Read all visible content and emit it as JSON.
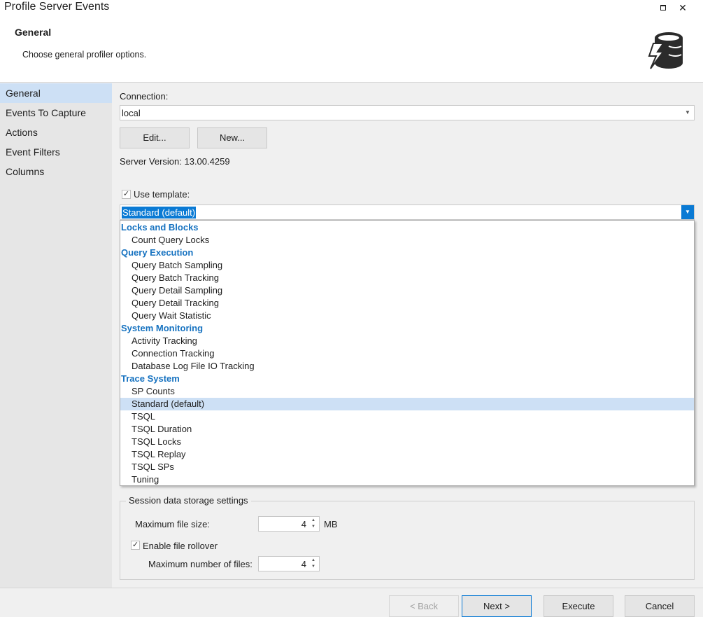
{
  "window": {
    "title": "Profile Server Events",
    "maximize_icon": "maximize-icon",
    "close_icon": "close-icon",
    "close_glyph": "✕"
  },
  "header": {
    "title": "General",
    "subtitle": "Choose general profiler options.",
    "icon": "database-lightning-icon"
  },
  "sidebar": {
    "items": [
      {
        "label": "General"
      },
      {
        "label": "Events To Capture"
      },
      {
        "label": "Actions"
      },
      {
        "label": "Event Filters"
      },
      {
        "label": "Columns"
      }
    ],
    "active": "General"
  },
  "connection": {
    "label": "Connection:",
    "value": "local",
    "edit_label": "Edit...",
    "new_label": "New..."
  },
  "server": {
    "version_text": "Server Version: 13.00.4259"
  },
  "template": {
    "checkbox_label": "Use template:",
    "checked": true,
    "selected": "Standard (default)",
    "groups": [
      {
        "name": "Locks and Blocks",
        "items": [
          "Count Query Locks"
        ]
      },
      {
        "name": "Query Execution",
        "items": [
          "Query Batch Sampling",
          "Query Batch Tracking",
          "Query Detail Sampling",
          "Query Detail Tracking",
          "Query Wait Statistic"
        ]
      },
      {
        "name": "System Monitoring",
        "items": [
          "Activity Tracking",
          "Connection Tracking",
          "Database Log File IO Tracking"
        ]
      },
      {
        "name": "Trace System",
        "items": [
          "SP Counts",
          "Standard (default)",
          "TSQL",
          "TSQL Duration",
          "TSQL Locks",
          "TSQL Replay",
          "TSQL SPs",
          "Tuning"
        ]
      }
    ]
  },
  "storage": {
    "legend": "Session data storage settings",
    "max_file_size_label": "Maximum file size:",
    "max_file_size": "4",
    "unit": "MB",
    "rollover_label": "Enable file rollover",
    "rollover_checked": true,
    "max_files_label": "Maximum number of files:",
    "max_files": "4"
  },
  "footer": {
    "back": "< Back",
    "next": "Next >",
    "execute": "Execute",
    "cancel": "Cancel"
  },
  "colors": {
    "accent": "#0a7ad4",
    "group_header": "#1672c0",
    "highlight": "#cde0f5"
  }
}
